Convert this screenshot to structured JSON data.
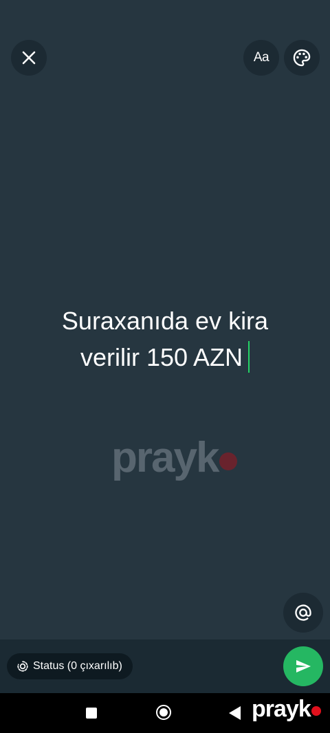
{
  "status_text": {
    "line1": "Suraxanıda ev kira",
    "line2": "verilir 150 AZN"
  },
  "toolbar": {
    "close_icon": "close-icon",
    "font_label": "Aa",
    "palette_icon": "palette-icon"
  },
  "mention_icon": "at-icon",
  "watermark": {
    "text": "prayk"
  },
  "bottom": {
    "status_chip_label": "Status (0 çıxarılıb)",
    "send_icon": "send-icon"
  },
  "corner_logo": {
    "text": "prayk"
  },
  "colors": {
    "background": "#263640",
    "accent": "#25b762",
    "caret": "#25d366",
    "logo_dot": "#e0101c"
  }
}
